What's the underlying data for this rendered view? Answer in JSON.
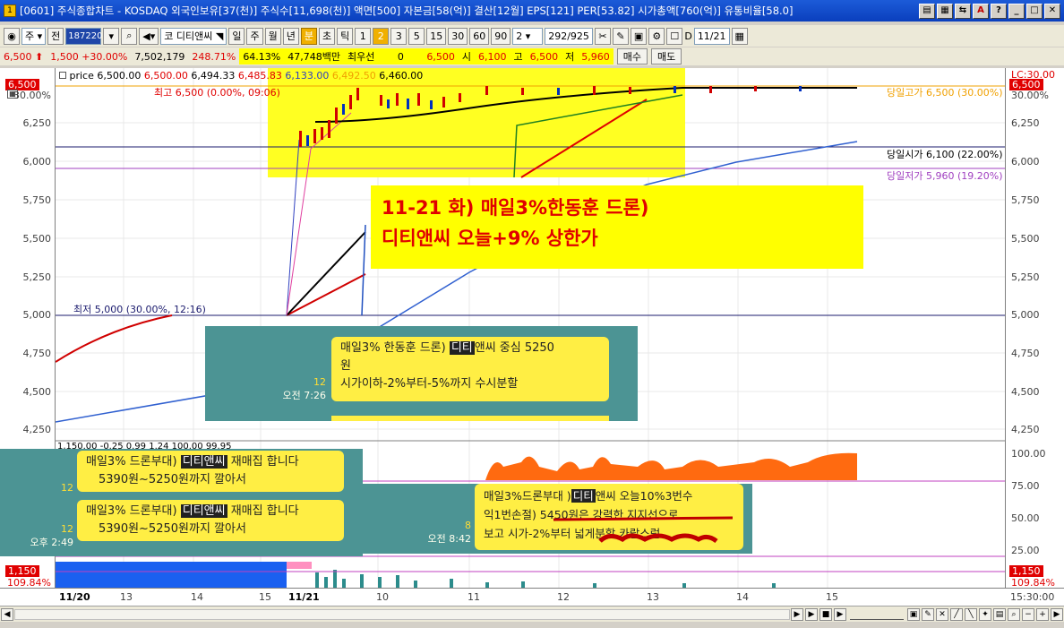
{
  "window": {
    "title": "[0601] 주식종합차트 - KOSDAQ 외국인보유[37(천)] 주식수[11,698(천)] 액면[500] 자본금[58(억)] 결산[12월] EPS[121] PER[53.82] 시가총액[760(억)] 유통비율[58.0]",
    "icon_label": "1"
  },
  "toolbar": {
    "mode": "주",
    "period_label": "전",
    "code": "187220",
    "stock_prefix": "코",
    "stock_name": "디티앤씨",
    "intervals": [
      "일",
      "주",
      "월",
      "년",
      "분",
      "초",
      "틱"
    ],
    "selected_interval": "분",
    "numbers": [
      "1",
      "2",
      "3",
      "5",
      "15",
      "30",
      "60",
      "90"
    ],
    "selected_number": "2",
    "multiplier": "2",
    "count": "292",
    "total": "/925",
    "d_label": "D",
    "date": "11/21"
  },
  "price_info": {
    "price": "6,500",
    "change": "1,500 +30.00%",
    "volume": "7,502,179",
    "volume_ratio": "248.71%",
    "turnover": "64.13%",
    "amount": "47,748백만",
    "pref_label": "최우선",
    "pref_value": "0",
    "last": "6,500",
    "open_label": "시",
    "open": "6,100",
    "high_label": "고",
    "high": "6,500",
    "low_label": "저",
    "low": "5,960",
    "buy_label": "매수",
    "sell_label": "매도"
  },
  "chart": {
    "legend_price": "price",
    "legend_values": [
      "6,500.00",
      "6,500.00",
      "6,494.33",
      "6,485.83",
      "6,133.00",
      "6,492.50",
      "6,460.00"
    ],
    "high_annot": "최고 6,500 (0.00%, 09:06)",
    "low_annot": "최저 5,000 (30.00%, 12:16)",
    "day_high": "당일고가 6,500 (30.00%)",
    "day_open": "당일시가 6,100 (22.00%)",
    "day_low": "당일저가 5,960 (19.20%)",
    "lc_label": "LC:30.00",
    "right_price": "6,500",
    "left_price": "6,500",
    "left_pct": "30.00%",
    "y_ticks": [
      "6,250",
      "6,000",
      "5,750",
      "5,500",
      "5,250",
      "5,000",
      "4,750",
      "4,500",
      "4,250"
    ],
    "indicator_legend": "1,150.00 -0.25 0.99 1.24 100.00 99.95",
    "osc_ticks": [
      "100.00",
      "75.00",
      "50.00",
      "25.00"
    ],
    "vol_value": "1,150",
    "vol_pct": "109.84%",
    "dates": [
      "11/20",
      "13",
      "14",
      "15",
      "11/21",
      "10",
      "11",
      "12",
      "13",
      "14",
      "15"
    ],
    "time_label": "15:30:00"
  },
  "note": {
    "line1": "11-21 화) 매일3%한동훈 드론)",
    "line2": "디티앤씨 오늘+9% 상한가"
  },
  "chats": {
    "c1": {
      "pre": "매일3% 한동훈 드론)",
      "hl": "디티",
      "post": "앤씨 중심 5250",
      "line2": "원",
      "line3": "시가이하-2%부터-5%까지 수시분할",
      "num": "12",
      "time": "오전 7:26"
    },
    "c2": {
      "pre": "매일3% 드론부대)",
      "hl": "디티앤씨",
      "post": "재매집 합니다",
      "line2": "5390원~5250원까지 깔아서",
      "num": "12"
    },
    "c3": {
      "pre": "매일3% 드론부대)",
      "hl": "디티앤씨",
      "post": "재매집 합니다",
      "line2": "5390원~5250원까지 깔아서",
      "num": "12",
      "time": "오후 2:49"
    },
    "c4": {
      "pre": "매일3%드론부대 )",
      "hl": "디티",
      "post": "앤씨 오늘10%3번수",
      "line2": "익1번손절)  5450원은 강력한 지지선으로",
      "line3": "보고 시가-2%부터 넓게분할 카랄스럼",
      "num": "8",
      "time": "오전 8:42"
    }
  },
  "colors": {
    "up": "#e00000",
    "highlight": "#ffff00",
    "chat_bg": "#4c9494",
    "bubble": "#ffee44"
  }
}
